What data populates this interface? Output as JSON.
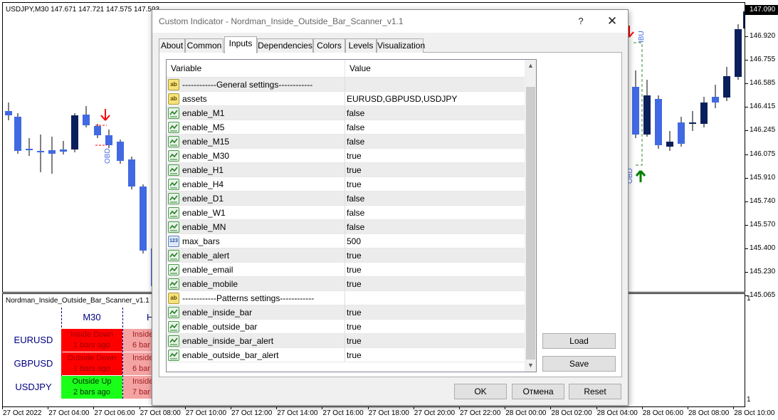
{
  "chart": {
    "symbol_info": "USDJPY,M30  147.671 147.721 147.575 147.593",
    "current_price": "147.090",
    "price_labels": [
      "146.920",
      "146.755",
      "146.585",
      "146.415",
      "146.245",
      "146.075",
      "145.910",
      "145.740",
      "145.570",
      "145.400",
      "145.230",
      "145.065"
    ],
    "indicator_scale_top": "1",
    "indicator_scale_bottom": "1",
    "time_labels": [
      "27 Oct 2022",
      "27 Oct 04:00",
      "27 Oct 06:00",
      "27 Oct 08:00",
      "27 Oct 10:00",
      "27 Oct 12:00",
      "27 Oct 14:00",
      "27 Oct 16:00",
      "27 Oct 18:00",
      "27 Oct 20:00",
      "27 Oct 22:00",
      "28 Oct 00:00",
      "28 Oct 02:00",
      "28 Oct 04:00",
      "28 Oct 06:00",
      "28 Oct 08:00",
      "28 Oct 10:00"
    ],
    "annotation_obd_left": "OBD",
    "annotation_ibu": "IBU",
    "annotation_obd_right": "OBD",
    "colors": {
      "bull": "#4169e1",
      "bear": "#0a1f5c",
      "arrow_down": "#ff0000",
      "arrow_up": "#008000"
    }
  },
  "indicator": {
    "name": "Nordman_Inside_Outside_Bar_Scanner_v1.1",
    "columns": [
      "M30",
      "H"
    ],
    "rows": [
      {
        "symbol": "EURUSD",
        "m30_line1": "Inside Down",
        "m30_line2": "1 bars ago",
        "m30_color": "#ff0000",
        "m30_text": "#a00000",
        "h_line1": "Inside",
        "h_line2": "6 bar"
      },
      {
        "symbol": "GBPUSD",
        "m30_line1": "Outside Down",
        "m30_line2": "1 bars ago",
        "m30_color": "#ff0000",
        "m30_text": "#a00000",
        "h_line1": "Inside",
        "h_line2": "6 bar"
      },
      {
        "symbol": "USDJPY",
        "m30_line1": "Outside Up",
        "m30_line2": "2 bars ago",
        "m30_color": "#1aff1a",
        "m30_text": "#003000",
        "h_line1": "Inside",
        "h_line2": "7 bar"
      }
    ],
    "h_cell_color": "#f4a3a3",
    "h_cell_text": "#a02020"
  },
  "dialog": {
    "title": "Custom Indicator - Nordman_Inside_Outside_Bar_Scanner_v1.1",
    "help": "?",
    "close": "✕",
    "tabs": [
      {
        "label": "About"
      },
      {
        "label": "Common"
      },
      {
        "label": "Inputs"
      },
      {
        "label": "Dependencies"
      },
      {
        "label": "Colors"
      },
      {
        "label": "Levels"
      },
      {
        "label": "Visualization"
      }
    ],
    "active_tab": "Inputs",
    "grid": {
      "col_variable": "Variable",
      "col_value": "Value",
      "rows": [
        {
          "type": "str",
          "variable": "------------General settings------------",
          "value": ""
        },
        {
          "type": "str",
          "variable": "assets",
          "value": "EURUSD,GBPUSD,USDJPY"
        },
        {
          "type": "bool",
          "variable": "enable_M1",
          "value": "false"
        },
        {
          "type": "bool",
          "variable": "enable_M5",
          "value": "false"
        },
        {
          "type": "bool",
          "variable": "enable_M15",
          "value": "false"
        },
        {
          "type": "bool",
          "variable": "enable_M30",
          "value": "true"
        },
        {
          "type": "bool",
          "variable": "enable_H1",
          "value": "true"
        },
        {
          "type": "bool",
          "variable": "enable_H4",
          "value": "true"
        },
        {
          "type": "bool",
          "variable": "enable_D1",
          "value": "false"
        },
        {
          "type": "bool",
          "variable": "enable_W1",
          "value": "false"
        },
        {
          "type": "bool",
          "variable": "enable_MN",
          "value": "false"
        },
        {
          "type": "int",
          "variable": "max_bars",
          "value": "500"
        },
        {
          "type": "bool",
          "variable": "enable_alert",
          "value": "true"
        },
        {
          "type": "bool",
          "variable": "enable_email",
          "value": "true"
        },
        {
          "type": "bool",
          "variable": "enable_mobile",
          "value": "true"
        },
        {
          "type": "str",
          "variable": "------------Patterns settings------------",
          "value": ""
        },
        {
          "type": "bool",
          "variable": "enable_inside_bar",
          "value": "true"
        },
        {
          "type": "bool",
          "variable": "enable_outside_bar",
          "value": "true"
        },
        {
          "type": "bool",
          "variable": "enable_inside_bar_alert",
          "value": "true"
        },
        {
          "type": "bool",
          "variable": "enable_outside_bar_alert",
          "value": "true"
        }
      ]
    },
    "icon_labels": {
      "str": "ab",
      "int": "123"
    },
    "buttons": {
      "load": "Load",
      "save": "Save",
      "ok": "OK",
      "cancel": "Отмена",
      "reset": "Reset"
    }
  }
}
